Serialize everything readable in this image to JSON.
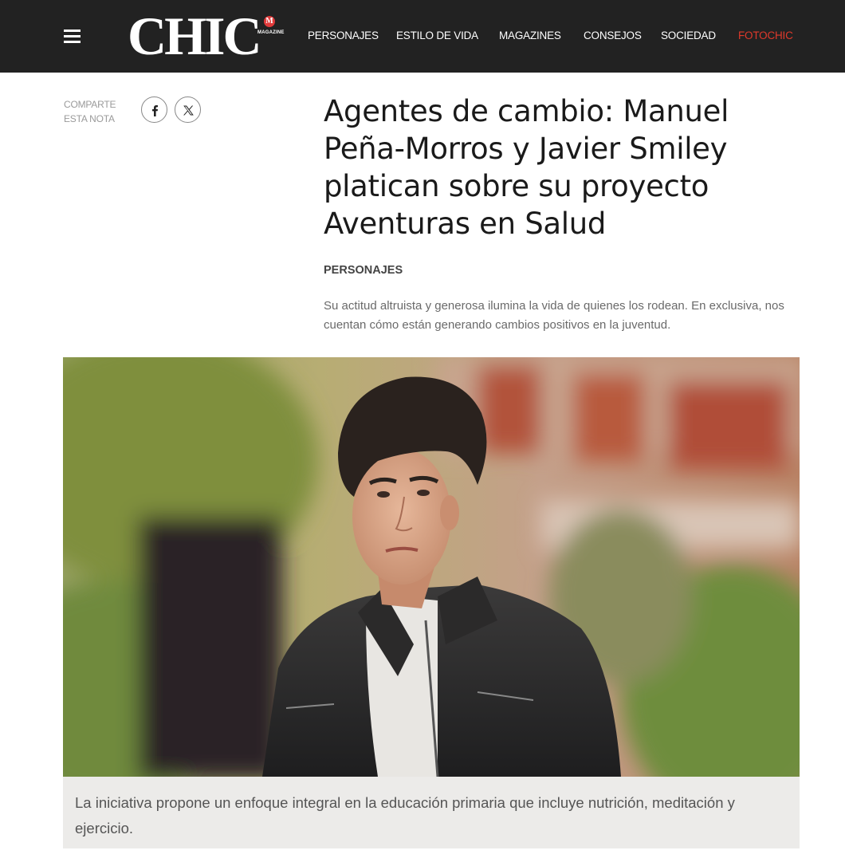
{
  "header": {
    "logo_text": "CHIC",
    "logo_badge": "M",
    "logo_sub": "MAGAZINE",
    "nav": [
      {
        "label": "PERSONAJES",
        "accent": false
      },
      {
        "label": "ESTILO DE VIDA",
        "accent": false
      },
      {
        "label": "MAGAZINES",
        "accent": false
      },
      {
        "label": "CONSEJOS",
        "accent": false
      },
      {
        "label": "SOCIEDAD",
        "accent": false
      },
      {
        "label": "FOTOCHIC",
        "accent": true
      }
    ],
    "accent_color": "#e0392b",
    "background_color": "#222222"
  },
  "share": {
    "label_line1": "COMPARTE",
    "label_line2": "ESTA NOTA",
    "icons": [
      "facebook-icon",
      "x-icon"
    ]
  },
  "article": {
    "title": "Agentes de cambio: Manuel Peña-Morros y Javier Smiley platican sobre su proyecto Aventuras en Salud",
    "category": "PERSONAJES",
    "dek": "Su actitud altruista y generosa ilumina la vida de quienes los rodean. En exclusiva, nos cuentan cómo están generando cambios positivos en la juventud.",
    "caption": "La iniciativa propone un enfoque integral en la educación primaria que incluye nutrición, meditación y ejercicio."
  }
}
